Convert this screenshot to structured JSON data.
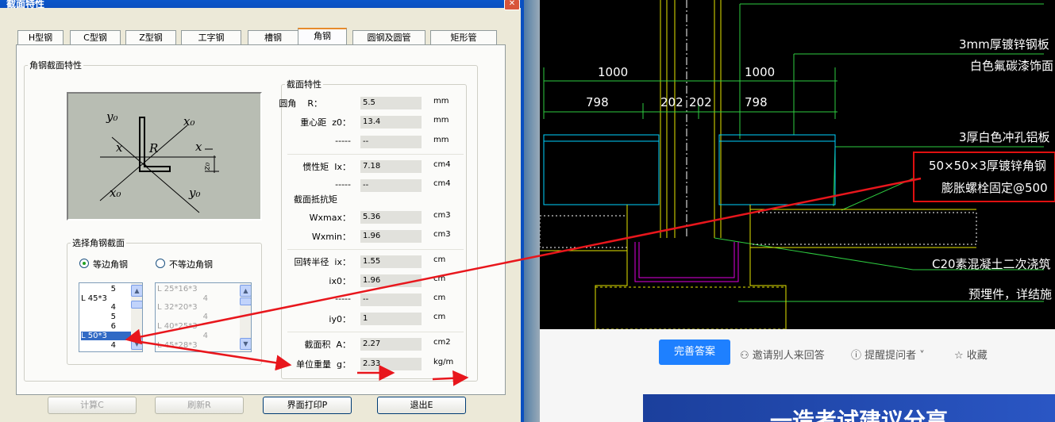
{
  "dialog": {
    "title": "截面特性",
    "tabs": [
      "H型钢",
      "C型钢",
      "Z型钢",
      "工字钢",
      "槽钢",
      "角钢",
      "圆钢及圆管",
      "矩形管"
    ],
    "active_tab": "角钢",
    "group_title": "角钢截面特性",
    "figure_labels": {
      "y0_top": "y₀",
      "x0_top": "x₀",
      "x_left": "x",
      "R": "R",
      "x_right": "x",
      "z0": "z₀",
      "x0_bottom": "x₀",
      "y0_bottom": "y₀"
    },
    "select_group": {
      "title": "选择角钢截面",
      "radio_equal": "等边角钢",
      "radio_unequal": "不等边角钢",
      "selected_radio": "equal",
      "list_equal": [
        "5",
        "L 45*3",
        "4",
        "5",
        "6",
        "L 50*3",
        "4"
      ],
      "list_equal_selected": "L 50*3",
      "list_unequal": [
        "L 25*16*3",
        "4",
        "L 32*20*3",
        "4",
        "L 40*25*3",
        "4",
        "L 45*28*3"
      ]
    },
    "section_props": {
      "title": "截面特性",
      "rows": [
        {
          "label": "圆角    R：",
          "value": "5.5",
          "unit": "mm"
        },
        {
          "label": "重心距  z0：",
          "value": "13.4",
          "unit": "mm"
        },
        {
          "label": "-----",
          "value": "--",
          "unit": "mm"
        },
        {
          "label": "惯性矩  Ix：",
          "value": "7.18",
          "unit": "cm4"
        },
        {
          "label": "-----",
          "value": "--",
          "unit": "cm4"
        },
        {
          "label": "Wxmax：",
          "value": "5.36",
          "unit": "cm3"
        },
        {
          "label": "Wxmin：",
          "value": "1.96",
          "unit": "cm3"
        },
        {
          "label": "回转半径  ix：",
          "value": "1.55",
          "unit": "cm"
        },
        {
          "label": "ix0：",
          "value": "1.96",
          "unit": "cm"
        },
        {
          "label": "-----",
          "value": "--",
          "unit": "cm"
        },
        {
          "label": "iy0：",
          "value": "1",
          "unit": "cm"
        },
        {
          "label": "截面积  A：",
          "value": "2.27",
          "unit": "cm2"
        },
        {
          "label": "单位重量  g：",
          "value": "2.33",
          "unit": "kg/m"
        }
      ],
      "sub_label": "截面抵抗矩"
    },
    "buttons": {
      "calc": "计算C",
      "refresh": "刷新R",
      "print": "界面打印P",
      "exit": "退出E"
    }
  },
  "cad": {
    "dims": [
      "1000",
      "1000",
      "798",
      "202",
      "202",
      "798"
    ],
    "notes": [
      "3mm厚镀锌钢板",
      "白色氟碳漆饰面",
      "3厚白色冲孔铝板",
      "50×50×3厚镀锌角钢",
      "膨胀螺栓固定@500",
      "C20素混凝土二次浇筑",
      "预埋件，详结施"
    ],
    "colors": {
      "background": "#000000",
      "green": "#2ecc40",
      "yellow": "#e6e600",
      "cyan": "#00d2ff",
      "magenta": "#e000e0",
      "highlight_red": "#e01010"
    }
  },
  "web": {
    "answer_button": "完善答案",
    "invite": "邀请别人来回答",
    "remind": "提醒提问者",
    "collect": "收藏",
    "banner_text": "一造考试建议分享"
  },
  "annotation_color": "#e8161c"
}
